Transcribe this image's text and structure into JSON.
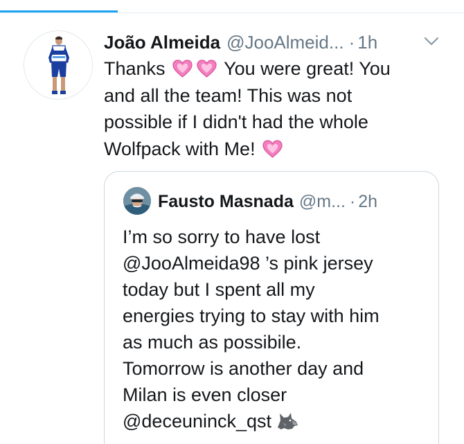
{
  "tweet": {
    "author_name": "João Almeida",
    "author_handle": "@JooAlmeid...",
    "dot": "·",
    "time": "1h",
    "menu_icon": "chevron-down-icon",
    "body_lines": [
      {
        "before": "Thanks",
        "after": "You were great! You"
      },
      "and all the team! This was not",
      "possible if I didn't had the whole",
      "Wolfpack with Me!"
    ],
    "emoji": "pink-heart-icon"
  },
  "quoted_tweet": {
    "author_name": "Fausto Masnada",
    "author_handle": "@m...",
    "dot": "·",
    "time": "2h",
    "body_lines": [
      "I’m so sorry to have lost",
      "@JooAlmeida98 ’s pink jersey",
      "today but I spent all my",
      "energies trying to stay with him",
      "as much as possibile.",
      "Tomorrow is another day and",
      "Milan is even closer",
      "@deceuninck_qst"
    ],
    "emoji": "wolf-icon"
  },
  "colors": {
    "accent": "#1da1f2",
    "secondary_text": "#657786",
    "primary_text": "#14171a",
    "heart": "#f27fbf",
    "border": "#ccd6dd"
  }
}
